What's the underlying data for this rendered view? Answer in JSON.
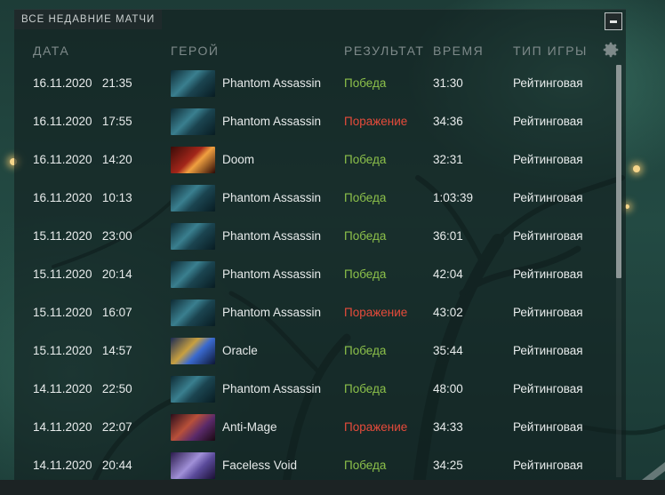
{
  "panel": {
    "title": "ВСЕ НЕДАВНИЕ МАТЧИ",
    "minimize_icon": "minimize-icon",
    "settings_icon": "gear-icon"
  },
  "columns": {
    "date": "ДАТА",
    "hero": "ГЕРОЙ",
    "result": "РЕЗУЛЬТАТ",
    "duration": "ВРЕМЯ",
    "mode": "ТИП ИГРЫ"
  },
  "colors": {
    "win": "#8cc04a",
    "loss": "#e64b3b"
  },
  "matches": [
    {
      "date": "16.11.2020   21:35",
      "hero": "Phantom Assassin",
      "hero_icon": "phantom-assassin-portrait",
      "result": "Победа",
      "win": true,
      "duration": "31:30",
      "mode": "Рейтинговая"
    },
    {
      "date": "16.11.2020   17:55",
      "hero": "Phantom Assassin",
      "hero_icon": "phantom-assassin-portrait",
      "result": "Поражение",
      "win": false,
      "duration": "34:36",
      "mode": "Рейтинговая"
    },
    {
      "date": "16.11.2020   14:20",
      "hero": "Doom",
      "hero_icon": "doom-portrait",
      "result": "Победа",
      "win": true,
      "duration": "32:31",
      "mode": "Рейтинговая"
    },
    {
      "date": "16.11.2020   10:13",
      "hero": "Phantom Assassin",
      "hero_icon": "phantom-assassin-portrait",
      "result": "Победа",
      "win": true,
      "duration": "1:03:39",
      "mode": "Рейтинговая"
    },
    {
      "date": "15.11.2020   23:00",
      "hero": "Phantom Assassin",
      "hero_icon": "phantom-assassin-portrait",
      "result": "Победа",
      "win": true,
      "duration": "36:01",
      "mode": "Рейтинговая"
    },
    {
      "date": "15.11.2020   20:14",
      "hero": "Phantom Assassin",
      "hero_icon": "phantom-assassin-portrait",
      "result": "Победа",
      "win": true,
      "duration": "42:04",
      "mode": "Рейтинговая"
    },
    {
      "date": "15.11.2020   16:07",
      "hero": "Phantom Assassin",
      "hero_icon": "phantom-assassin-portrait",
      "result": "Поражение",
      "win": false,
      "duration": "43:02",
      "mode": "Рейтинговая"
    },
    {
      "date": "15.11.2020   14:57",
      "hero": "Oracle",
      "hero_icon": "oracle-portrait",
      "result": "Победа",
      "win": true,
      "duration": "35:44",
      "mode": "Рейтинговая"
    },
    {
      "date": "14.11.2020   22:50",
      "hero": "Phantom Assassin",
      "hero_icon": "phantom-assassin-portrait",
      "result": "Победа",
      "win": true,
      "duration": "48:00",
      "mode": "Рейтинговая"
    },
    {
      "date": "14.11.2020   22:07",
      "hero": "Anti-Mage",
      "hero_icon": "anti-mage-portrait",
      "result": "Поражение",
      "win": false,
      "duration": "34:33",
      "mode": "Рейтинговая"
    },
    {
      "date": "14.11.2020   20:44",
      "hero": "Faceless Void",
      "hero_icon": "faceless-void-portrait",
      "result": "Победа",
      "win": true,
      "duration": "34:25",
      "mode": "Рейтинговая"
    }
  ]
}
